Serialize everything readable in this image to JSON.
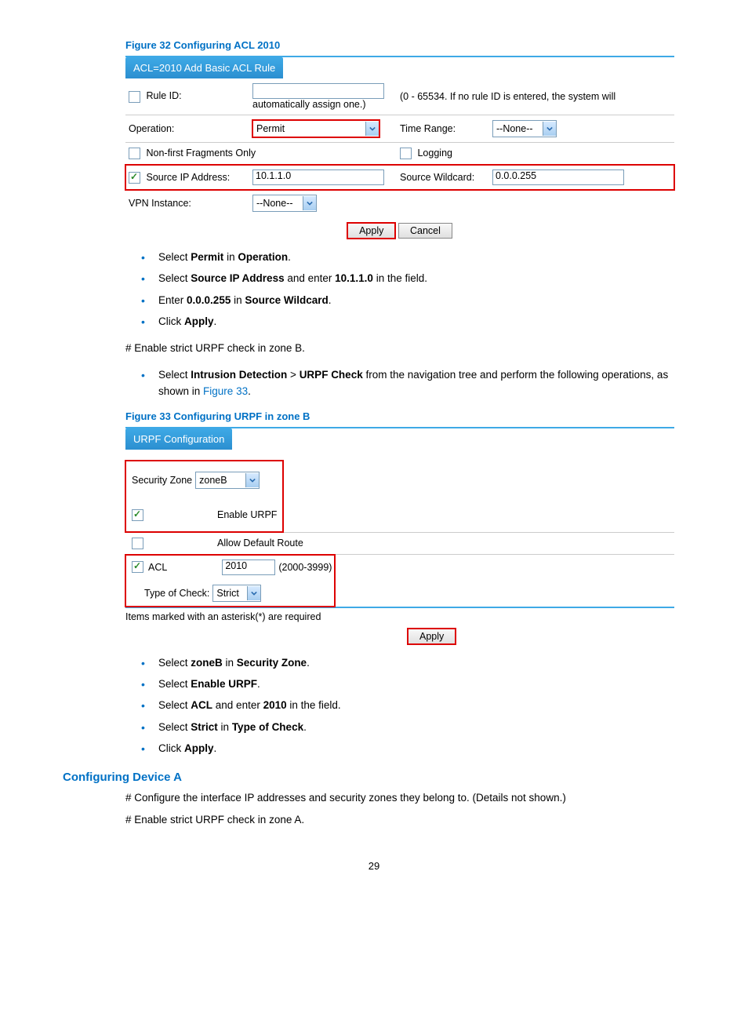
{
  "fig32": {
    "caption": "Figure 32 Configuring ACL 2010",
    "tab": "ACL=2010 Add Basic ACL Rule",
    "rule_id_label": "Rule ID:",
    "rule_id_hint1": "(0 - 65534. If no rule ID is entered, the system will",
    "rule_id_hint2": "automatically assign one.)",
    "operation_label": "Operation:",
    "operation_value": "Permit",
    "time_range_label": "Time Range:",
    "time_range_value": "--None--",
    "nonfirst_label": "Non-first Fragments Only",
    "logging_label": "Logging",
    "srcip_label": "Source IP Address:",
    "srcip_value": "10.1.1.0",
    "srcwild_label": "Source Wildcard:",
    "srcwild_value": "0.0.0.255",
    "vpn_label": "VPN Instance:",
    "vpn_value": "--None--",
    "apply": "Apply",
    "cancel": "Cancel"
  },
  "instr1": {
    "i1a": "Select ",
    "i1b": "Permit",
    "i1c": " in ",
    "i1d": "Operation",
    "i1e": ".",
    "i2a": "Select ",
    "i2b": "Source IP Address",
    "i2c": " and enter ",
    "i2d": "10.1.1.0",
    "i2e": " in the field.",
    "i3a": "Enter ",
    "i3b": "0.0.0.255",
    "i3c": " in ",
    "i3d": "Source Wildcard",
    "i3e": ".",
    "i4a": "Click ",
    "i4b": "Apply",
    "i4c": "."
  },
  "para1": "# Enable strict URPF check in zone B.",
  "instr2": {
    "a": "Select ",
    "b": "Intrusion Detection",
    "c": " > ",
    "d": "URPF Check",
    "e": " from the navigation tree and perform the following operations, as shown in ",
    "f": "Figure 33",
    "g": "."
  },
  "fig33": {
    "caption": "Figure 33 Configuring URPF in zone B",
    "tab": "URPF Configuration",
    "seczone_label": "Security Zone",
    "seczone_value": "zoneB",
    "enable_label": "Enable URPF",
    "allow_label": "Allow Default Route",
    "acl_label": "ACL",
    "acl_value": "2010",
    "acl_hint": "(2000-3999)",
    "type_label": "Type of Check:",
    "type_value": "Strict",
    "note": "Items marked with an asterisk(*) are required",
    "apply": "Apply"
  },
  "instr3": {
    "i1a": "Select ",
    "i1b": "zoneB",
    "i1c": " in ",
    "i1d": "Security Zone",
    "i1e": ".",
    "i2a": "Select ",
    "i2b": "Enable URPF",
    "i2c": ".",
    "i3a": "Select ",
    "i3b": "ACL",
    "i3c": " and enter ",
    "i3d": "2010",
    "i3e": " in the field.",
    "i4a": "Select ",
    "i4b": "Strict",
    "i4c": " in ",
    "i4d": "Type of Check",
    "i4e": ".",
    "i5a": "Click ",
    "i5b": "Apply",
    "i5c": "."
  },
  "heading": "Configuring Device A",
  "para2": "# Configure the interface IP addresses and security zones they belong to. (Details not shown.)",
  "para3": "# Enable strict URPF check in zone A.",
  "pagenum": "29"
}
